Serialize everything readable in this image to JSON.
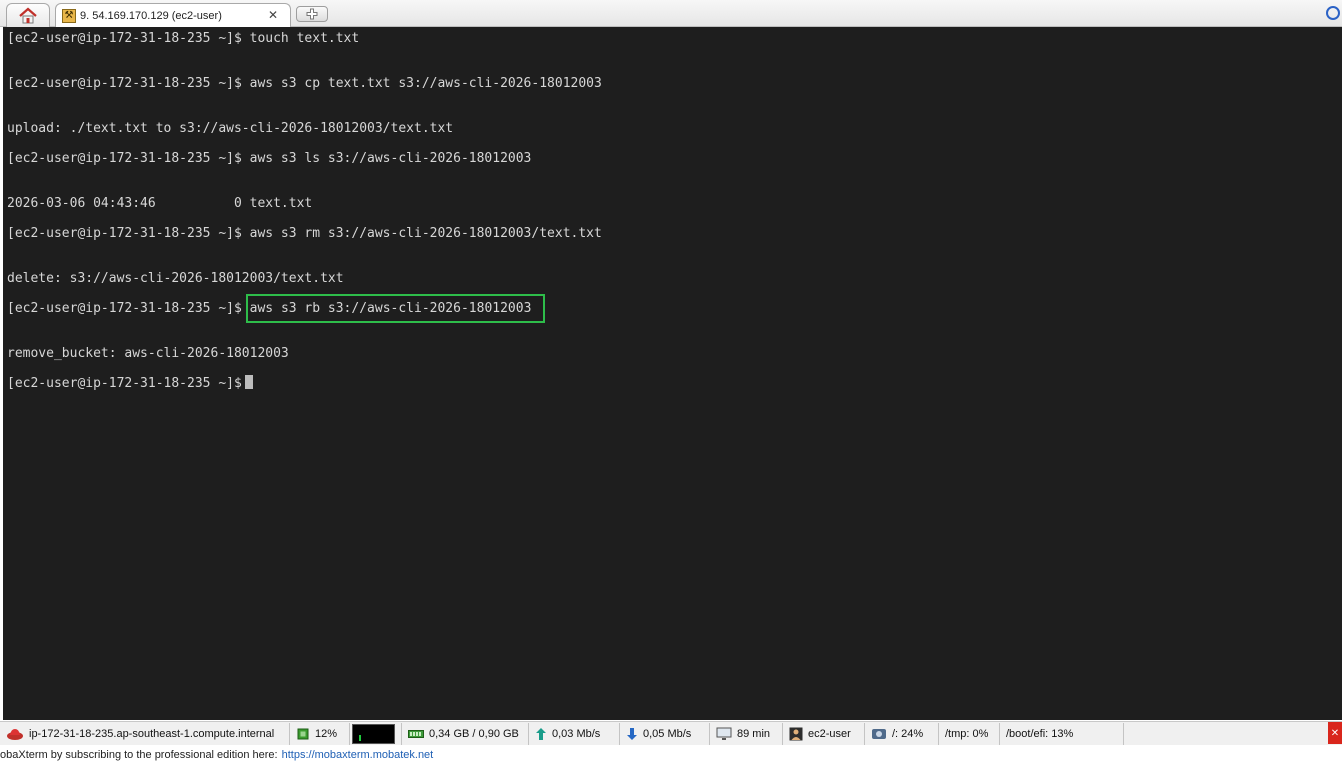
{
  "tabs": {
    "home_icon": "house-icon",
    "session_label": "9. 54.169.170.129 (ec2-user)",
    "session_icon": "wrench-icon",
    "close_glyph": "✕",
    "new_tab_icon": "plus-icon"
  },
  "terminal": {
    "lines": [
      "[ec2-user@ip-172-31-18-235 ~]$ touch text.txt",
      "[ec2-user@ip-172-31-18-235 ~]$ aws s3 cp text.txt s3://aws-cli-2026-18012003",
      "upload: ./text.txt to s3://aws-cli-2026-18012003/text.txt",
      "[ec2-user@ip-172-31-18-235 ~]$ aws s3 ls s3://aws-cli-2026-18012003",
      "2026-03-06 04:43:46          0 text.txt",
      "[ec2-user@ip-172-31-18-235 ~]$ aws s3 rm s3://aws-cli-2026-18012003/text.txt",
      "delete: s3://aws-cli-2026-18012003/text.txt",
      "[ec2-user@ip-172-31-18-235 ~]$ ",
      "remove_bucket: aws-cli-2026-18012003",
      "[ec2-user@ip-172-31-18-235 ~]$"
    ],
    "highlighted_command": "aws s3 rb s3://aws-cli-2026-18012003",
    "highlight_color": "#2ebd4a",
    "background": "#1e1e1e",
    "foreground": "#d7d7d7"
  },
  "statusbar": {
    "hostname": "ip-172-31-18-235.ap-southeast-1.compute.internal",
    "cpu": "12%",
    "memory": "0,34 GB / 0,90 GB",
    "upload": "0,03 Mb/s",
    "download": "0,05 Mb/s",
    "uptime": "89 min",
    "user": "ec2-user",
    "disk_root": "/: 24%",
    "disk_tmp": "/tmp: 0%",
    "disk_boot": "/boot/efi: 13%"
  },
  "promo": {
    "text": "obaXterm by subscribing to the professional edition here:",
    "link": "https://mobaxterm.mobatek.net"
  }
}
